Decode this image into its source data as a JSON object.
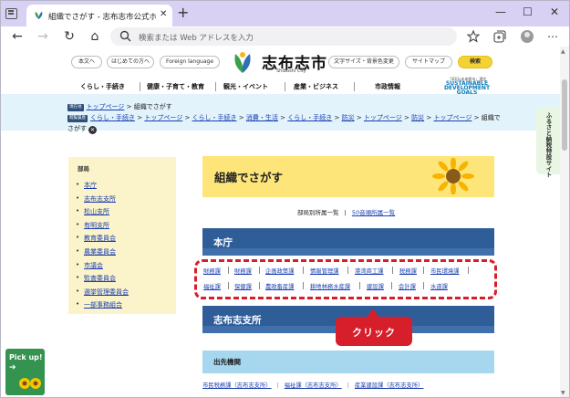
{
  "browser": {
    "tab_title": "組織でさがす - 志布志市公式ホームページ",
    "tab_close": "✕",
    "new_tab": "+",
    "window_controls": {
      "minimize": "—",
      "maximize": "☐",
      "close": "✕"
    },
    "address_placeholder": "検索または Web アドレスを入力",
    "nav": {
      "back": "←",
      "forward": "→",
      "reload": "↻",
      "home": "⌂"
    }
  },
  "header": {
    "utility_links": [
      "本文へ",
      "はじめての方へ",
      "Foreign language"
    ],
    "logo_text": "志布志市",
    "logo_sub": "Shibushi City",
    "settings_link": "文字サイズ・背景色変更",
    "sitemap_link": "サイトマップ",
    "search_button": "検索",
    "sdgs_line1": "「SDGs未来都市」選定",
    "sdgs_line2": "SUSTAINABLE DEVELOPMENT GOALS"
  },
  "main_nav": [
    "くらし・手続き",
    "健康・子育て・教育",
    "観光・イベント",
    "産業・ビジネス",
    "市政情報"
  ],
  "breadcrumbs": {
    "current_tag": "現在地",
    "current_path": [
      "トップページ",
      "組織でさがす"
    ],
    "history_tag": "閲覧履歴",
    "history_path": [
      "くらし・手続き",
      "トップページ",
      "くらし・手続き",
      "消費・生活",
      "くらし・手続き",
      "防災",
      "トップページ",
      "防災",
      "トップページ",
      "組織でさがす"
    ],
    "separator": ">",
    "clear": "✕"
  },
  "side_tab": "ふるさと納税特設サイト",
  "sidebar": {
    "heading": "部局",
    "items": [
      "本庁",
      "志布志支所",
      "松山支所",
      "有明支所",
      "教育委員会",
      "農業委員会",
      "市議会",
      "監査委員会",
      "選挙管理委員会",
      "一部事務組合"
    ]
  },
  "content": {
    "title": "組織でさがす",
    "subnav_text": "部局別所属一覧",
    "subnav_sep": "|",
    "subnav_link": "50音順所属一覧",
    "honcho_heading": "本庁",
    "honcho_row1": [
      "財務課",
      "財務課",
      "企画政策課",
      "情報管理課",
      "港湾商工課",
      "税務課",
      "市民環境課"
    ],
    "honcho_row2": [
      "福祉課",
      "保健課",
      "農政畜産課",
      "耕地林務水産課",
      "建設課",
      "会計課",
      "水道課"
    ],
    "shibushi_heading": "志布志支所",
    "callout": "クリック",
    "branch_heading": "出先機関",
    "branch_links": [
      "市民税務課（志布志支所）",
      "福祉課（志布志支所）",
      "産業建設課（志布志支所）"
    ]
  },
  "pickup": {
    "label": "Pick up!",
    "arrow": "➔"
  },
  "colors": {
    "tabbar": "#d9d1f4",
    "accent_yellow": "#fde57a",
    "section_blue": "#2f5d98",
    "branch_blue": "#a6d7ef",
    "highlight_red": "#d61f2b",
    "link": "#1a3fb0",
    "pickup_green": "#34934f"
  }
}
